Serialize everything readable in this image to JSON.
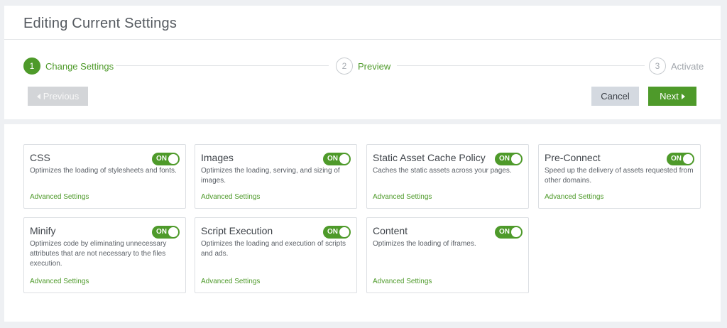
{
  "header": {
    "title": "Editing Current Settings"
  },
  "stepper": {
    "steps": [
      {
        "number": "1",
        "label": "Change Settings"
      },
      {
        "number": "2",
        "label": "Preview"
      },
      {
        "number": "3",
        "label": "Activate"
      }
    ]
  },
  "buttons": {
    "previous": "Previous",
    "cancel": "Cancel",
    "next": "Next"
  },
  "colors": {
    "accent": "#4e9a2a",
    "disabled": "#d3d5d8",
    "cancel_bg": "#d4d9e0"
  },
  "cards": [
    {
      "title": "CSS",
      "toggle": "ON",
      "description": "Optimizes the loading of stylesheets and fonts.",
      "link": "Advanced Settings"
    },
    {
      "title": "Images",
      "toggle": "ON",
      "description": "Optimizes the loading, serving, and sizing of images.",
      "link": "Advanced Settings"
    },
    {
      "title": "Static Asset Cache Policy",
      "toggle": "ON",
      "description": "Caches the static assets across your pages.",
      "link": "Advanced Settings"
    },
    {
      "title": "Pre-Connect",
      "toggle": "ON",
      "description": "Speed up the delivery of assets requested from other domains.",
      "link": "Advanced Settings"
    },
    {
      "title": "Minify",
      "toggle": "ON",
      "description": "Optimizes code by eliminating unnecessary attributes that are not necessary to the files execution.",
      "link": "Advanced Settings"
    },
    {
      "title": "Script Execution",
      "toggle": "ON",
      "description": "Optimizes the loading and execution of scripts and ads.",
      "link": "Advanced Settings"
    },
    {
      "title": "Content",
      "toggle": "ON",
      "description": "Optimizes the loading of iframes.",
      "link": "Advanced Settings"
    }
  ]
}
